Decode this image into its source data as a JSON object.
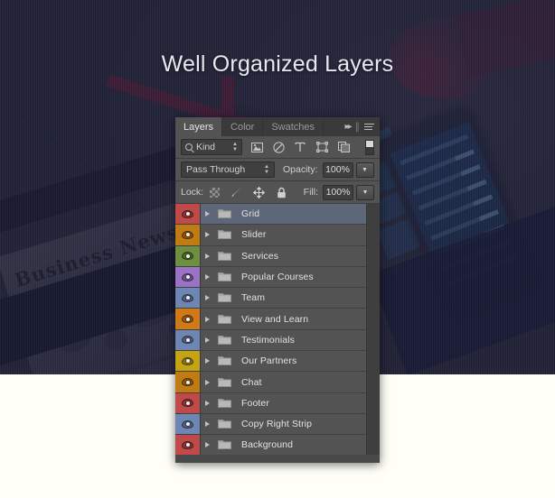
{
  "page": {
    "title": "Well Organized Layers",
    "background_color": "#2a2a3d",
    "lower_background_color": "#fffff8",
    "newspaper_masthead": "Business News"
  },
  "panel": {
    "tabs": [
      {
        "label": "Layers",
        "active": true
      },
      {
        "label": "Color",
        "active": false
      },
      {
        "label": "Swatches",
        "active": false
      }
    ],
    "collapse_icon": "double-chevron-right-icon",
    "menu_icon": "panel-menu-icon",
    "filter_row": {
      "search_icon": "magnifier-icon",
      "kind_label": "Kind",
      "stepper_icon": "up-down-stepper-icon",
      "icons": [
        "pixel-layer-filter-icon",
        "adjustment-layer-filter-icon",
        "type-layer-filter-icon",
        "shape-layer-filter-icon",
        "smart-object-filter-icon"
      ],
      "toggle_icon": "filter-toggle-switch-icon"
    },
    "blend_row": {
      "blend_mode": "Pass Through",
      "opacity_label": "Opacity:",
      "opacity_value": "100%",
      "dropdown_icon": "chevron-down-icon"
    },
    "lock_row": {
      "lock_label": "Lock:",
      "lock_icons": [
        "lock-transparent-pixels-icon",
        "lock-image-pixels-icon",
        "lock-position-icon",
        "lock-all-icon"
      ],
      "fill_label": "Fill:",
      "fill_value": "100%",
      "dropdown_icon": "chevron-down-icon"
    },
    "layers": [
      {
        "name": "Grid",
        "color": "#c04a4a",
        "selected": true
      },
      {
        "name": "Slider",
        "color": "#c07b12",
        "selected": false
      },
      {
        "name": "Services",
        "color": "#6d8f3f",
        "selected": false
      },
      {
        "name": "Popular Courses",
        "color": "#9b72c4",
        "selected": false
      },
      {
        "name": "Team",
        "color": "#6d86b3",
        "selected": false
      },
      {
        "name": "View and Learn",
        "color": "#cf7a17",
        "selected": false
      },
      {
        "name": "Testimonials",
        "color": "#6d86b3",
        "selected": false
      },
      {
        "name": "Our Partners",
        "color": "#c4a413",
        "selected": false
      },
      {
        "name": "Chat",
        "color": "#c07b12",
        "selected": false
      },
      {
        "name": "Footer",
        "color": "#c04a4a",
        "selected": false
      },
      {
        "name": "Copy Right Strip",
        "color": "#6d86b3",
        "selected": false
      },
      {
        "name": "Background",
        "color": "#c04a4a",
        "selected": false
      }
    ],
    "row_icons": {
      "expand": "expand-triangle-icon",
      "folder": "folder-icon",
      "visibility": "eye-icon"
    }
  }
}
